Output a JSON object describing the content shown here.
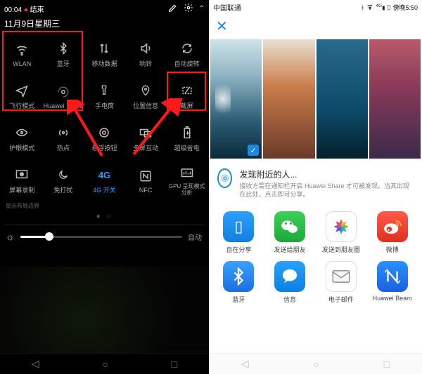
{
  "left": {
    "status": {
      "time": "00:04",
      "end_label": "结束"
    },
    "date": "11月9日星期三",
    "tiles": [
      {
        "name": "wlan",
        "label": "WLAN",
        "glyph": "wifi"
      },
      {
        "name": "bluetooth",
        "label": "蓝牙",
        "glyph": "bt"
      },
      {
        "name": "mobile-data",
        "label": "移动数据",
        "glyph": "data"
      },
      {
        "name": "ring",
        "label": "响铃",
        "glyph": "sound"
      },
      {
        "name": "auto-rotate",
        "label": "自动旋转",
        "glyph": "rotate"
      },
      {
        "name": "airplane",
        "label": "飞行模式",
        "glyph": "plane"
      },
      {
        "name": "huawei-share",
        "label": "Huawei Share",
        "glyph": "share"
      },
      {
        "name": "flashlight",
        "label": "手电筒",
        "glyph": "torch"
      },
      {
        "name": "location",
        "label": "位置信息",
        "glyph": "pin"
      },
      {
        "name": "screenshot",
        "label": "截屏",
        "glyph": "scissor"
      },
      {
        "name": "eye-comfort",
        "label": "护眼模式",
        "glyph": "eye"
      },
      {
        "name": "hotspot",
        "label": "热点",
        "glyph": "hotspot"
      },
      {
        "name": "float-button",
        "label": "悬浮按钮",
        "glyph": "float"
      },
      {
        "name": "multi-screen",
        "label": "多屏互动",
        "glyph": "multi"
      },
      {
        "name": "ultra-save",
        "label": "超级省电",
        "glyph": "battery"
      },
      {
        "name": "screen-record",
        "label": "屏幕录制",
        "glyph": "record"
      },
      {
        "name": "dnd",
        "label": "免打扰",
        "glyph": "moon"
      },
      {
        "name": "4g-switch",
        "label": "4G 开关",
        "glyph": "4g",
        "on": true
      },
      {
        "name": "nfc",
        "label": "NFC",
        "glyph": "nfc"
      },
      {
        "name": "gpu-analysis",
        "label": "GPU 呈现模式分析",
        "glyph": "gpu"
      }
    ],
    "edge_label": "显示布局边界",
    "brightness_auto": "自动"
  },
  "right": {
    "status": {
      "carrier": "中国联通",
      "time": "傍晚5:50"
    },
    "discover": {
      "title": "发现附近的人...",
      "subtitle": "接收方需在通知栏开启 Huawei Share 才可被发现。当其出现在此处，点击即可分享。"
    },
    "apps": [
      {
        "name": "self-share",
        "label": "自在分享",
        "style": "a-blue",
        "glyph": "▮"
      },
      {
        "name": "wechat-friend",
        "label": "发送给朋友",
        "style": "a-green",
        "glyph": "wechat"
      },
      {
        "name": "wechat-moments",
        "label": "发送到朋友圈",
        "style": "a-white",
        "glyph": "moments"
      },
      {
        "name": "weibo",
        "label": "微博",
        "style": "a-red",
        "glyph": "weibo"
      },
      {
        "name": "bluetooth",
        "label": "蓝牙",
        "style": "a-bt",
        "glyph": "bt"
      },
      {
        "name": "messages",
        "label": "信息",
        "style": "a-msg",
        "glyph": "●"
      },
      {
        "name": "email",
        "label": "电子邮件",
        "style": "a-mail",
        "glyph": "✉"
      },
      {
        "name": "huawei-beam",
        "label": "Huawei Beam",
        "style": "a-nfc",
        "glyph": "N"
      }
    ]
  }
}
